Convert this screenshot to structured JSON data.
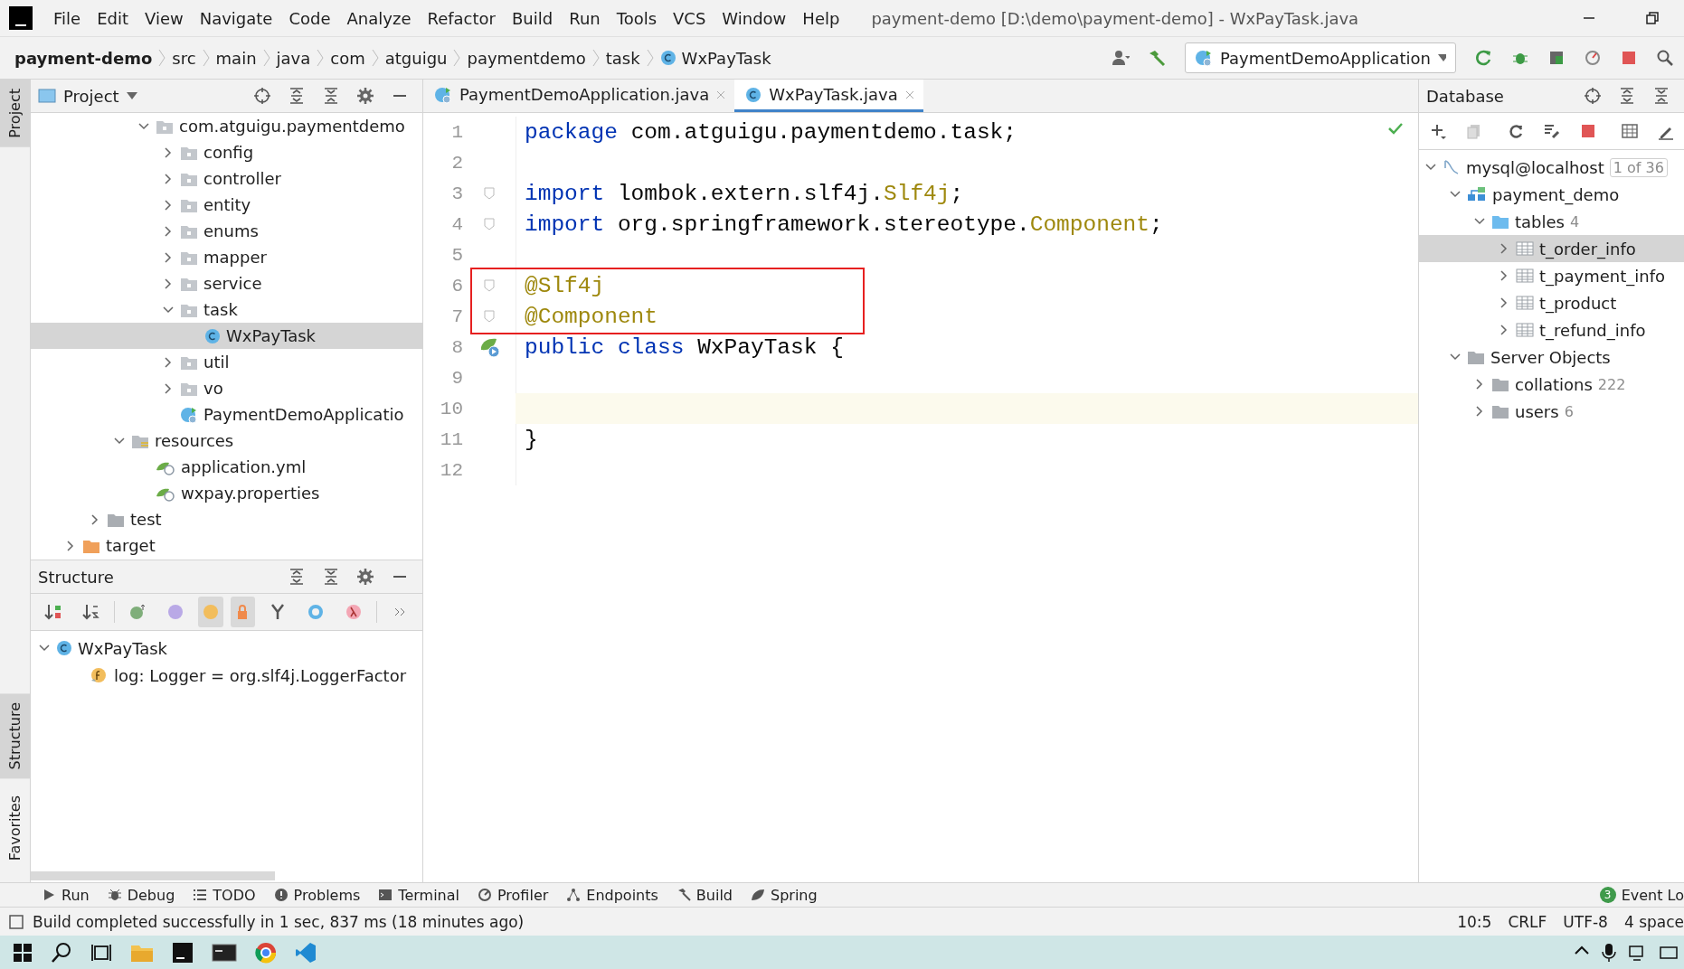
{
  "window": {
    "title": "payment-demo [D:\\demo\\payment-demo] - WxPayTask.java"
  },
  "menu": [
    "File",
    "Edit",
    "View",
    "Navigate",
    "Code",
    "Analyze",
    "Refactor",
    "Build",
    "Run",
    "Tools",
    "VCS",
    "Window",
    "Help"
  ],
  "breadcrumbs": [
    {
      "label": "payment-demo",
      "kind": "project"
    },
    {
      "label": "src",
      "kind": "folder"
    },
    {
      "label": "main",
      "kind": "folder"
    },
    {
      "label": "java",
      "kind": "folder"
    },
    {
      "label": "com",
      "kind": "folder"
    },
    {
      "label": "atguigu",
      "kind": "folder"
    },
    {
      "label": "paymentdemo",
      "kind": "folder"
    },
    {
      "label": "task",
      "kind": "folder"
    },
    {
      "label": "WxPayTask",
      "kind": "class"
    }
  ],
  "run_config": {
    "label": "PaymentDemoApplication"
  },
  "side_tabs": [
    {
      "label": "Project",
      "selected": true
    },
    {
      "label": "Structure",
      "selected": true
    },
    {
      "label": "Favorites",
      "selected": false
    }
  ],
  "project_panel": {
    "title": "Project",
    "tree": [
      {
        "label": "com.atguigu.paymentdemo",
        "kind": "package",
        "expanded": true,
        "selected": false,
        "children": [
          {
            "label": "config",
            "kind": "package",
            "expanded": false,
            "selected": false
          },
          {
            "label": "controller",
            "kind": "package",
            "expanded": false,
            "selected": false
          },
          {
            "label": "entity",
            "kind": "package",
            "expanded": false,
            "selected": false
          },
          {
            "label": "enums",
            "kind": "package",
            "expanded": false,
            "selected": false
          },
          {
            "label": "mapper",
            "kind": "package",
            "expanded": false,
            "selected": false
          },
          {
            "label": "service",
            "kind": "package",
            "expanded": false,
            "selected": false
          },
          {
            "label": "task",
            "kind": "package",
            "expanded": true,
            "selected": false,
            "children": [
              {
                "label": "WxPayTask",
                "kind": "class",
                "selected": true
              }
            ]
          },
          {
            "label": "util",
            "kind": "package",
            "expanded": false,
            "selected": false
          },
          {
            "label": "vo",
            "kind": "package",
            "expanded": false,
            "selected": false
          },
          {
            "label": "PaymentDemoApplicatio",
            "kind": "app",
            "selected": false
          }
        ]
      },
      {
        "label": "resources",
        "kind": "resources",
        "expanded": true,
        "selected": false,
        "children": [
          {
            "label": "application.yml",
            "kind": "spring",
            "selected": false
          },
          {
            "label": "wxpay.properties",
            "kind": "spring",
            "selected": false
          }
        ]
      },
      {
        "label": "test",
        "kind": "folder",
        "expanded": false,
        "selected": false
      },
      {
        "label": "target",
        "kind": "target",
        "expanded": false,
        "selected": false
      }
    ]
  },
  "structure_panel": {
    "title": "Structure",
    "tree": [
      {
        "label": "WxPayTask",
        "kind": "class",
        "expanded": true,
        "selected": false,
        "children": [
          {
            "label": "log: Logger = org.slf4j.LoggerFactor",
            "kind": "field",
            "selected": false
          }
        ]
      }
    ]
  },
  "editor": {
    "tabs": [
      {
        "label": "PaymentDemoApplication.java",
        "kind": "app",
        "selected": false
      },
      {
        "label": "WxPayTask.java",
        "kind": "class",
        "selected": true
      }
    ],
    "lines": [
      {
        "number": "1",
        "fold": false,
        "runnable": false,
        "boxed": false,
        "current": false,
        "tokens": [
          {
            "text": "package ",
            "kind": "keyword"
          },
          {
            "text": "com.atguigu.paymentdemo.task;",
            "kind": "plain"
          }
        ]
      },
      {
        "number": "2",
        "fold": false,
        "runnable": false,
        "boxed": false,
        "current": false
      },
      {
        "number": "3",
        "fold": true,
        "runnable": false,
        "boxed": false,
        "current": false,
        "tokens": [
          {
            "text": "import ",
            "kind": "keyword"
          },
          {
            "text": "lombok.extern.slf4j.",
            "kind": "plain"
          },
          {
            "text": "Slf4j",
            "kind": "annotation"
          },
          {
            "text": ";",
            "kind": "plain"
          }
        ]
      },
      {
        "number": "4",
        "fold": true,
        "runnable": false,
        "boxed": false,
        "current": false,
        "tokens": [
          {
            "text": "import ",
            "kind": "keyword"
          },
          {
            "text": "org.springframework.stereotype.",
            "kind": "plain"
          },
          {
            "text": "Component",
            "kind": "annotation"
          },
          {
            "text": ";",
            "kind": "plain"
          }
        ]
      },
      {
        "number": "5",
        "fold": false,
        "runnable": false,
        "boxed": false,
        "current": false
      },
      {
        "number": "6",
        "fold": true,
        "runnable": false,
        "boxed": true,
        "current": false,
        "tokens": [
          {
            "text": "@Slf4j",
            "kind": "annotation"
          }
        ]
      },
      {
        "number": "7",
        "fold": true,
        "runnable": false,
        "boxed": true,
        "current": false,
        "tokens": [
          {
            "text": "@Component",
            "kind": "annotation"
          }
        ]
      },
      {
        "number": "8",
        "fold": false,
        "runnable": true,
        "boxed": false,
        "current": false,
        "tokens": [
          {
            "text": "public class ",
            "kind": "keyword"
          },
          {
            "text": "WxPayTask {",
            "kind": "plain"
          }
        ]
      },
      {
        "number": "9",
        "fold": false,
        "runnable": false,
        "boxed": false,
        "current": false
      },
      {
        "number": "10",
        "fold": false,
        "runnable": false,
        "boxed": false,
        "current": true
      },
      {
        "number": "11",
        "fold": false,
        "runnable": false,
        "boxed": false,
        "current": false,
        "tokens": [
          {
            "text": "}",
            "kind": "plain"
          }
        ]
      },
      {
        "number": "12",
        "fold": false,
        "runnable": false,
        "boxed": false,
        "current": false
      }
    ]
  },
  "database_panel": {
    "title": "Database",
    "tree": [
      {
        "label": "mysql@localhost",
        "kind": "connection",
        "badge": "1 of 36",
        "expanded": true,
        "selected": false,
        "children": [
          {
            "label": "payment_demo",
            "kind": "schema",
            "expanded": true,
            "selected": false,
            "children": [
              {
                "label": "tables",
                "kind": "tables",
                "count": "4",
                "expanded": true,
                "selected": false,
                "children": [
                  {
                    "label": "t_order_info",
                    "kind": "table",
                    "expanded": false,
                    "selected": true
                  },
                  {
                    "label": "t_payment_info",
                    "kind": "table",
                    "expanded": false,
                    "selected": false
                  },
                  {
                    "label": "t_product",
                    "kind": "table",
                    "expanded": false,
                    "selected": false
                  },
                  {
                    "label": "t_refund_info",
                    "kind": "table",
                    "expanded": false,
                    "selected": false
                  }
                ]
              }
            ]
          },
          {
            "label": "Server Objects",
            "kind": "server",
            "expanded": true,
            "selected": false,
            "children": [
              {
                "label": "collations",
                "kind": "server",
                "count": "222",
                "expanded": false,
                "selected": false
              },
              {
                "label": "users",
                "kind": "server",
                "count": "6",
                "expanded": false,
                "selected": false
              }
            ]
          }
        ]
      }
    ]
  },
  "tool_tabs": [
    {
      "label": "Run",
      "kind": "run"
    },
    {
      "label": "Debug",
      "kind": "bug"
    },
    {
      "label": "TODO",
      "kind": "list"
    },
    {
      "label": "Problems",
      "kind": "problems"
    },
    {
      "label": "Terminal",
      "kind": "terminal"
    },
    {
      "label": "Profiler",
      "kind": "profiler"
    },
    {
      "label": "Endpoints",
      "kind": "endpoints"
    },
    {
      "label": "Build",
      "kind": "hammer"
    },
    {
      "label": "Spring",
      "kind": "spring"
    }
  ],
  "event_log": {
    "label": "Event Lo",
    "badge": "3"
  },
  "status_bar": {
    "message": "Build completed successfully in 1 sec, 837 ms (18 minutes ago)",
    "items": [
      "10:5",
      "CRLF",
      "UTF-8",
      "4 space"
    ]
  }
}
